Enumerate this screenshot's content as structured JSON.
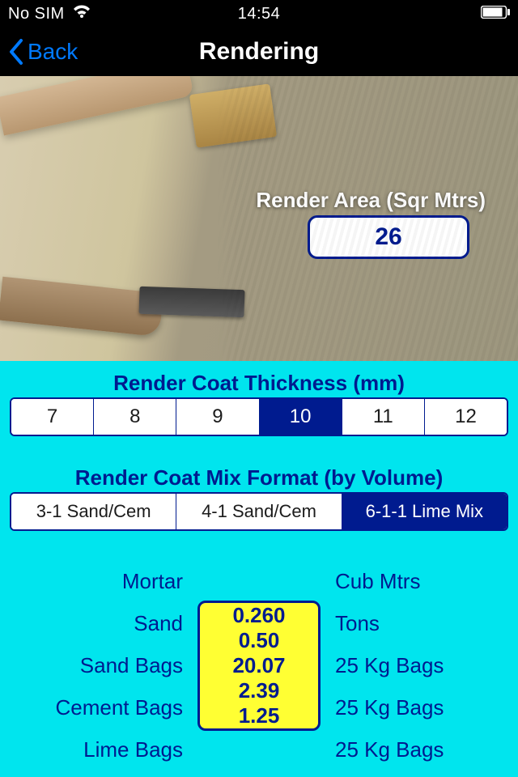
{
  "status": {
    "carrier": "No SIM",
    "time": "14:54"
  },
  "nav": {
    "back": "Back",
    "title": "Rendering"
  },
  "hero": {
    "area_label": "Render Area (Sqr Mtrs)",
    "area_value": "26"
  },
  "thickness": {
    "label": "Render Coat Thickness (mm)",
    "options": [
      "7",
      "8",
      "9",
      "10",
      "11",
      "12"
    ],
    "selected_index": 3
  },
  "mix": {
    "label": "Render Coat Mix Format (by Volume)",
    "options": [
      "3-1 Sand/Cem",
      "4-1 Sand/Cem",
      "6-1-1 Lime Mix"
    ],
    "selected_index": 2
  },
  "results": {
    "rows": [
      {
        "label": "Mortar",
        "value": "0.260",
        "unit": "Cub Mtrs"
      },
      {
        "label": "Sand",
        "value": "0.50",
        "unit": "Tons"
      },
      {
        "label": "Sand Bags",
        "value": "20.07",
        "unit": "25 Kg Bags"
      },
      {
        "label": "Cement Bags",
        "value": "2.39",
        "unit": "25 Kg Bags"
      },
      {
        "label": "Lime Bags",
        "value": "1.25",
        "unit": "25 Kg Bags"
      }
    ]
  }
}
